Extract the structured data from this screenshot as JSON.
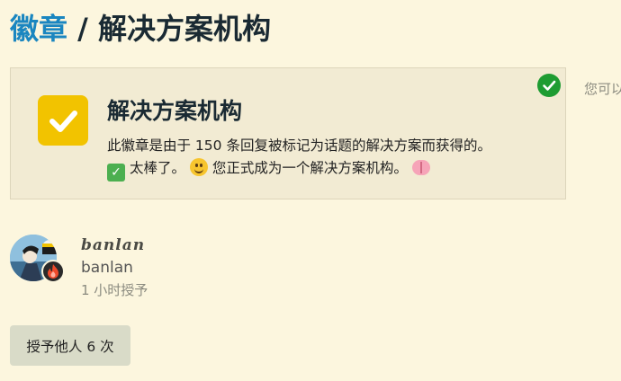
{
  "header": {
    "breadcrumb_root": "徽章",
    "separator": "/",
    "current": "解决方案机构"
  },
  "badge": {
    "name": "解决方案机构",
    "description_line1": "此徽章是由于 150 条回复被标记为话题的解决方案而获得的。",
    "description_line2_a": "太棒了。",
    "description_line2_b": "您正式成为一个解决方案机构。",
    "icon": "check-icon",
    "icon_color": "#f2c300",
    "granted_icon": "check-circle-icon",
    "granted_color": "#1e9c32"
  },
  "side": {
    "hint": "您可以"
  },
  "user": {
    "title": "banlan",
    "username": "banlan",
    "granted_time": "1 小时授予"
  },
  "action": {
    "grant_label": "授予他人 6 次"
  },
  "colors": {
    "background": "#fcf6de",
    "link": "#1a86c0",
    "card": "#f2ebd3"
  }
}
